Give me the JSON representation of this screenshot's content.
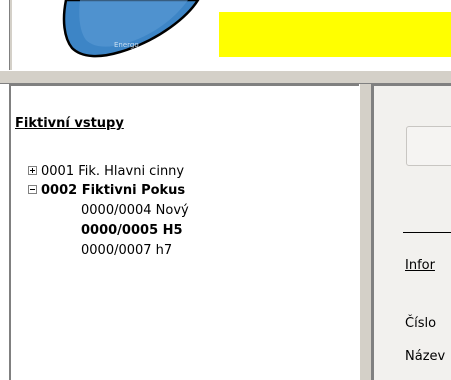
{
  "header": {
    "logo_name": "logo",
    "logo_text": "Energo",
    "banner_color": "#ffff00"
  },
  "tree": {
    "title": "Fiktivní vstupy",
    "nodes": [
      {
        "label": "0001 Fik. Hlavni cinny",
        "expanded": false,
        "bold": false
      },
      {
        "label": "0002 Fiktivni Pokus",
        "expanded": true,
        "bold": true,
        "children": [
          {
            "label": "0000/0004 Nový",
            "bold": false
          },
          {
            "label": "0000/0005 H5",
            "bold": true
          },
          {
            "label": "0000/0007 h7",
            "bold": false
          }
        ]
      }
    ]
  },
  "detail": {
    "link": "Infor",
    "labels": [
      "Číslo",
      "Název"
    ]
  }
}
